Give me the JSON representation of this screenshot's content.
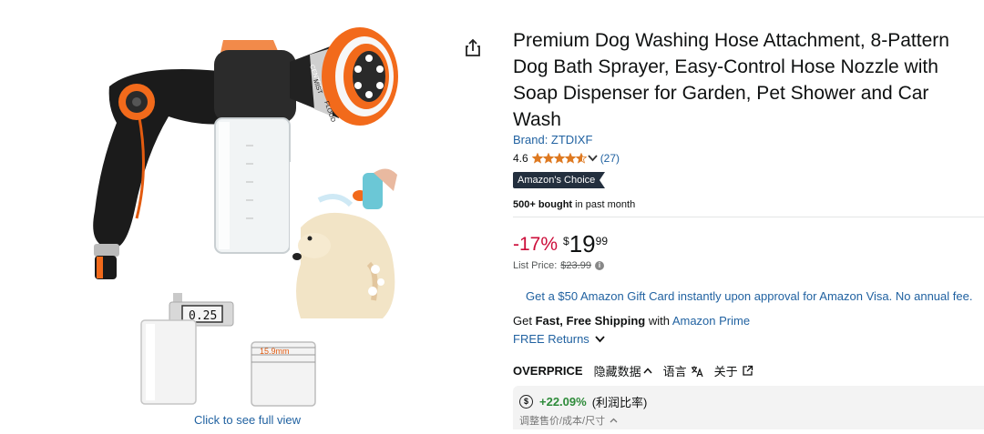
{
  "product": {
    "title": "Premium Dog Washing Hose Attachment, 8-Pattern Dog Bath Sprayer, Easy-Control Hose Nozzle with Soap Dispenser for Garden, Pet Shower and Car Wash",
    "brand": "Brand: ZTDIXF",
    "rating": "4.6",
    "rating_stars_value": 4.6,
    "rating_count": "(27)",
    "badge": "Amazon's Choice",
    "bought_bold": "500+ bought",
    "bought_rest": " in past month"
  },
  "price": {
    "discount": "-17%",
    "currency": "$",
    "whole": "19",
    "fraction": "99",
    "list_label": "List Price:",
    "list_value": "$23.99",
    "info_icon": "i"
  },
  "offers": {
    "gift_card": "Get a $50 Amazon Gift Card instantly upon approval for Amazon Visa. No annual fee.",
    "shipping_pre": "Get ",
    "shipping_bold": "Fast, Free Shipping",
    "shipping_mid": " with ",
    "shipping_link": "Amazon Prime",
    "returns": "FREE Returns"
  },
  "gallery": {
    "click_full_view": "Click to see full view",
    "caliper_reading": "0.25",
    "cylinder_label": "15.9mm",
    "nozzle_labels": [
      "CENTER",
      "MIST",
      "FLOOD"
    ]
  },
  "extension": {
    "brand": "OVERPRICE",
    "hide_data": "隐藏数据",
    "language": "语言",
    "about": "关于",
    "dollar_icon": "$",
    "profit_pct": "+22.09%",
    "profit_label": "(利润比率)",
    "adjust_label": "调整售价/成本/尺寸"
  },
  "colors": {
    "link": "#2162a1",
    "discount": "#cc0c39",
    "star": "#de7921",
    "badge_bg": "#232f3e",
    "profit": "#2e8b3a",
    "nozzle_orange": "#f26a1b"
  },
  "icons": [
    "share-icon",
    "star-icon",
    "chevron-down-icon",
    "info-icon",
    "translate-icon",
    "external-link-icon",
    "chevron-up-icon",
    "dollar-circle-icon"
  ]
}
